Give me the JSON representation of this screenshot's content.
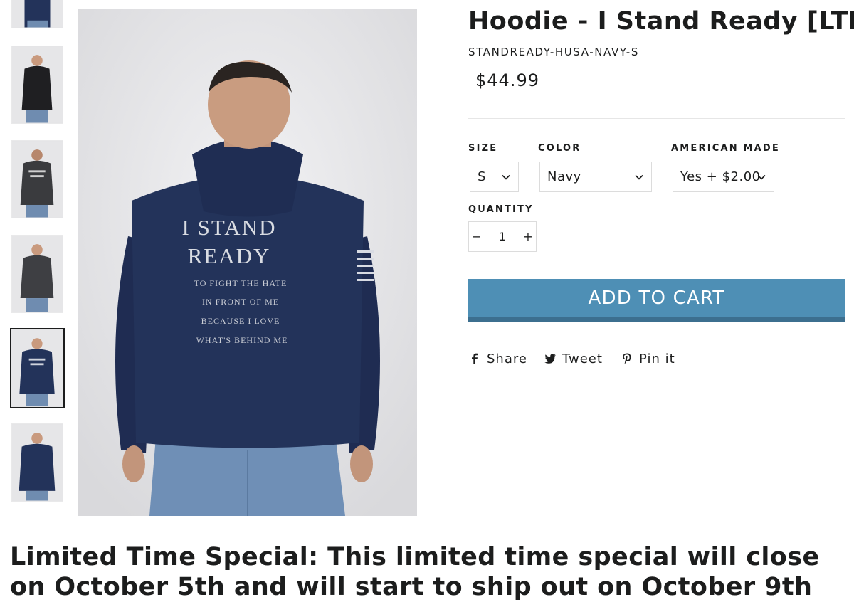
{
  "product": {
    "title": "Hoodie - I Stand Ready [LTD]",
    "sku": "STANDREADY-HUSA-NAVY-S",
    "price": "$44.99"
  },
  "hoodie_print": {
    "line1": "I STAND",
    "line2": "READY",
    "line3": "TO FIGHT THE HATE",
    "line4": "IN FRONT OF ME",
    "line5": "BECAUSE I LOVE",
    "line6": "WHAT'S BEHIND ME"
  },
  "options": {
    "size": {
      "label": "SIZE",
      "value": "S"
    },
    "color": {
      "label": "COLOR",
      "value": "Navy"
    },
    "american_made": {
      "label": "AMERICAN MADE",
      "value": "Yes + $2.00"
    }
  },
  "quantity": {
    "label": "QUANTITY",
    "minus": "−",
    "value": "1",
    "plus": "+"
  },
  "add_to_cart": "ADD TO CART",
  "social": {
    "share": "Share",
    "tweet": "Tweet",
    "pin": "Pin it"
  },
  "special": "Limited Time Special: This limited time special will close on October 5th and will start to ship out on October 9th",
  "colors": {
    "button": "#4e8fb5",
    "navy": "#23335a",
    "charcoal": "#3a3b3e",
    "black": "#1f1f22"
  },
  "icons": [
    "chevron-down-icon",
    "facebook-icon",
    "twitter-icon",
    "pinterest-icon"
  ]
}
